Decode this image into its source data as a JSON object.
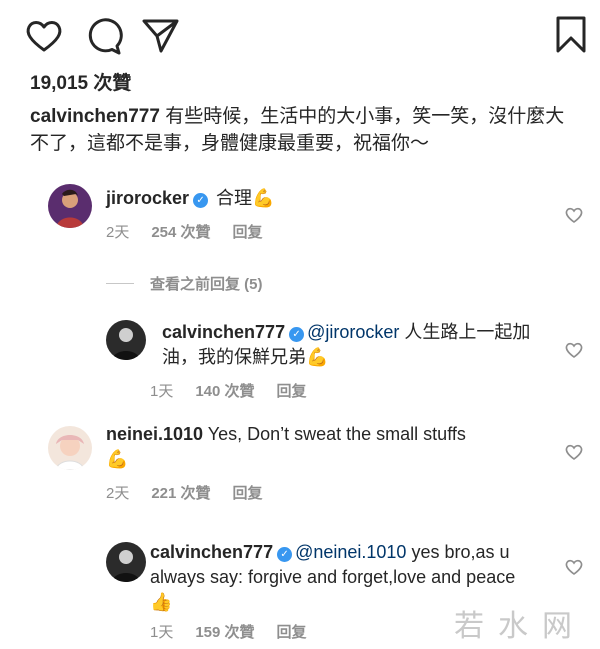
{
  "post": {
    "likes": "19,015 次贊",
    "caption_user": "calvinchen777",
    "caption_text": " 有些時候，生活中的大小事，笑一笑，沒什麼大不了，這都不是事，身體健康最重要，祝福你～"
  },
  "comments": [
    {
      "user": "jirorocker",
      "text": " 合理",
      "emoji": "💪",
      "time": "2天",
      "likes": "254 次贊",
      "reply": "回复"
    },
    {
      "view_replies": "查看之前回复 (5)"
    },
    {
      "user": "calvinchen777",
      "mention": "@jirorocker",
      "text": " 人生路上一起加油，我的保鮮兄弟",
      "emoji": "💪",
      "time": "1天",
      "likes": "140 次贊",
      "reply": "回复"
    },
    {
      "user": "neinei.1010",
      "text": " Yes, Don’t sweat the small stuffs",
      "emoji": "💪",
      "time": "2天",
      "likes": "221 次贊",
      "reply": "回复"
    },
    {
      "user": "calvinchen777",
      "mention": "@neinei.1010",
      "text": " yes bro,as u always say: forgive and forget,love and peace",
      "emoji": "👍",
      "time": "1天",
      "likes": "159 次贊",
      "reply": "回复"
    }
  ],
  "watermark": "若水网",
  "icons": [
    "heart-icon",
    "comment-icon",
    "share-icon",
    "bookmark-icon",
    "verified-badge-icon"
  ],
  "colors": {
    "text": "#262626",
    "meta": "#8e8e8e",
    "mention": "#003569",
    "verified": "#3897f0"
  }
}
